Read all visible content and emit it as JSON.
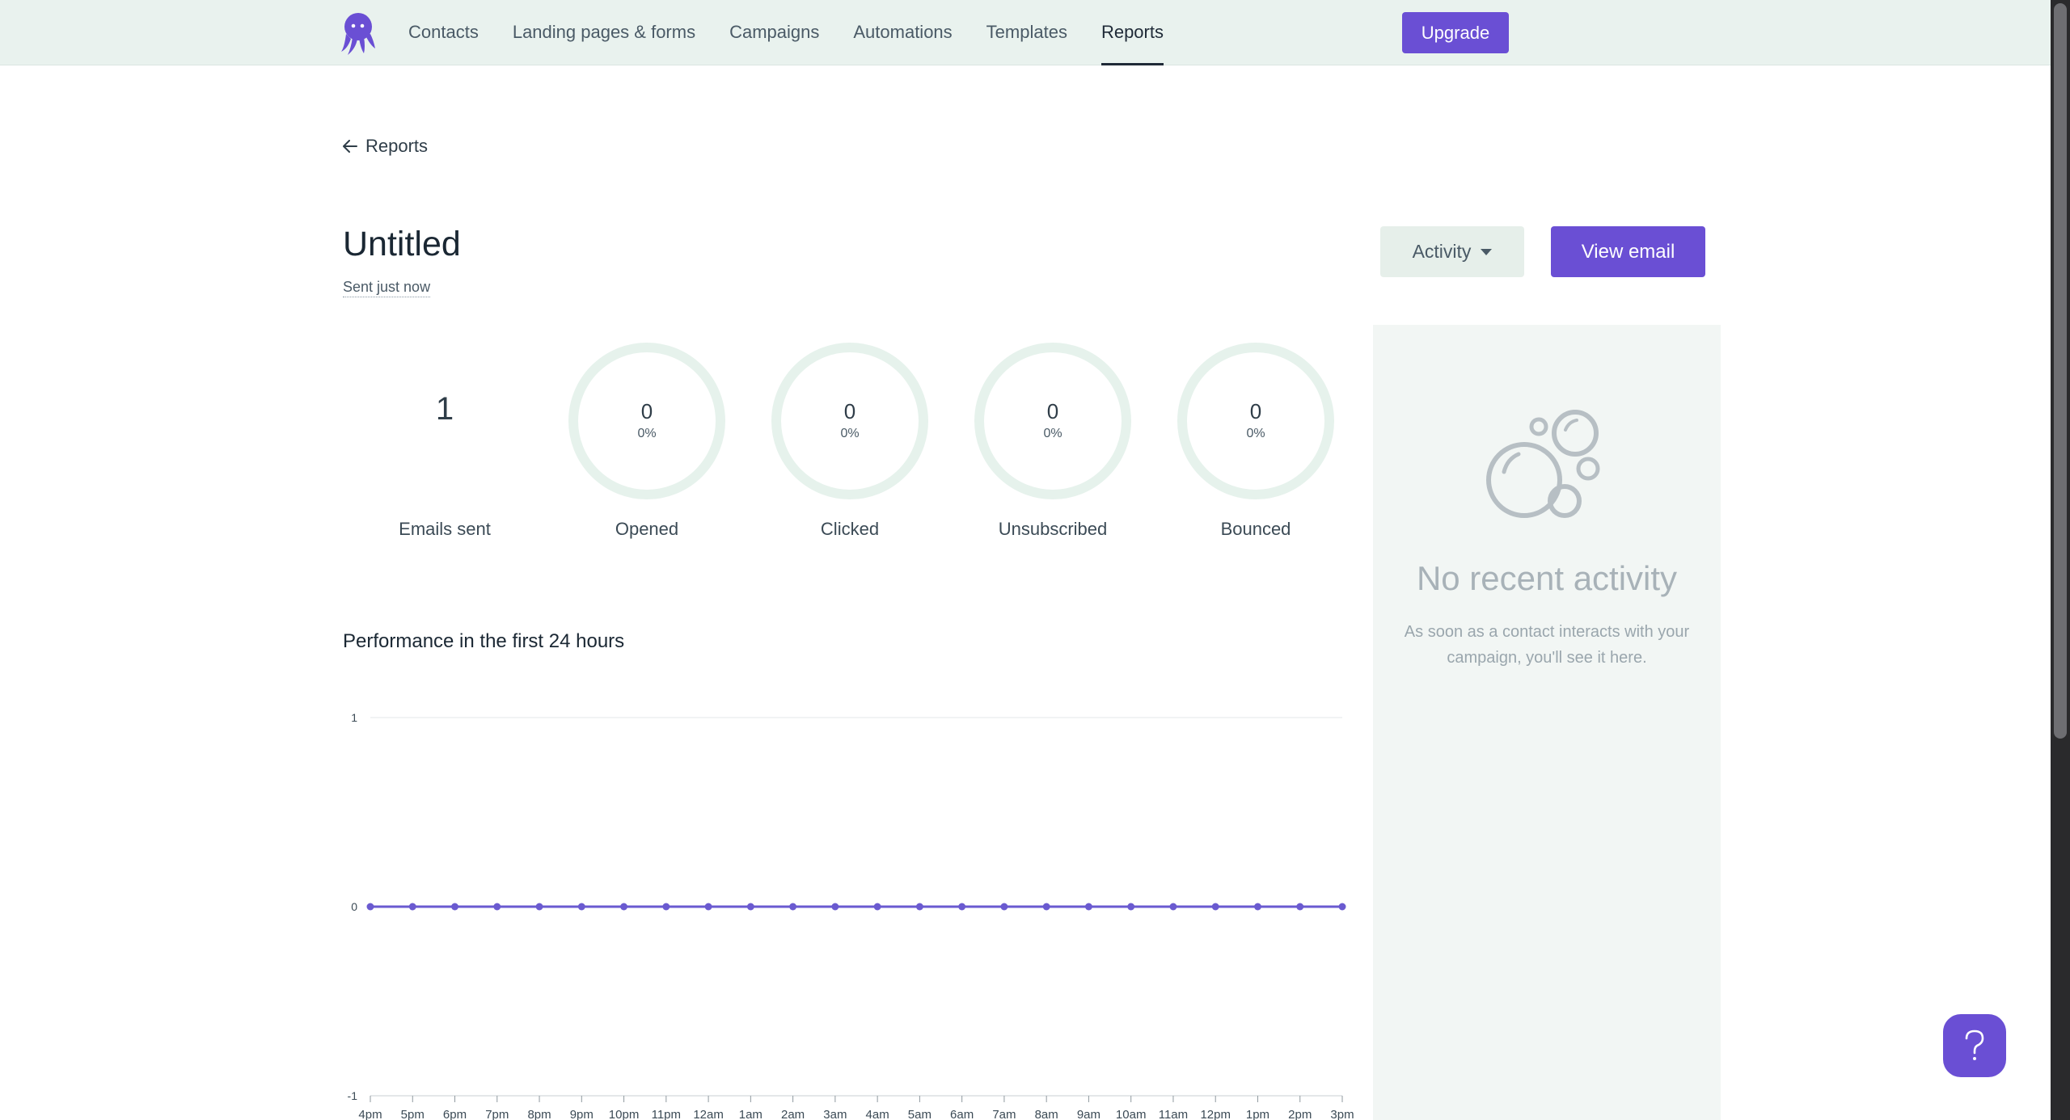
{
  "nav": {
    "items": [
      {
        "label": "Contacts"
      },
      {
        "label": "Landing pages & forms"
      },
      {
        "label": "Campaigns"
      },
      {
        "label": "Automations"
      },
      {
        "label": "Templates"
      },
      {
        "label": "Reports",
        "active": true
      }
    ],
    "upgrade_label": "Upgrade"
  },
  "header": {
    "back_label": "Reports",
    "title": "Untitled",
    "subtitle": "Sent just now",
    "activity_label": "Activity",
    "view_email_label": "View email"
  },
  "stats": {
    "emails_sent": {
      "value": "1",
      "label": "Emails sent"
    },
    "opened": {
      "value": "0",
      "pct": "0%",
      "label": "Opened"
    },
    "clicked": {
      "value": "0",
      "pct": "0%",
      "label": "Clicked"
    },
    "unsubscribed": {
      "value": "0",
      "pct": "0%",
      "label": "Unsubscribed"
    },
    "bounced": {
      "value": "0",
      "pct": "0%",
      "label": "Bounced"
    }
  },
  "performance": {
    "title": "Performance in the first 24 hours"
  },
  "chart_data": {
    "type": "line",
    "title": "Performance in the first 24 hours",
    "x": [
      "4pm",
      "5pm",
      "6pm",
      "7pm",
      "8pm",
      "9pm",
      "10pm",
      "11pm",
      "12am",
      "1am",
      "2am",
      "3am",
      "4am",
      "5am",
      "6am",
      "7am",
      "8am",
      "9am",
      "10am",
      "11am",
      "12pm",
      "1pm",
      "2pm",
      "3pm"
    ],
    "series": [
      {
        "values": [
          0,
          0,
          0,
          0,
          0,
          0,
          0,
          0,
          0,
          0,
          0,
          0,
          0,
          0,
          0,
          0,
          0,
          0,
          0,
          0,
          0,
          0,
          0,
          0
        ]
      }
    ],
    "ylim": [
      -1,
      1
    ],
    "yticks": [
      "1",
      "0",
      "-1"
    ],
    "grid": true,
    "color": "#6a5ad0"
  },
  "activity_panel": {
    "title": "No recent activity",
    "text": "As soon as a contact interacts with your campaign, you'll see it here."
  },
  "help": {
    "icon": "question-icon"
  },
  "colors": {
    "brand": "#6a4fd4",
    "nav_bg": "#e9f2ee",
    "ring": "#e6f2ec"
  }
}
